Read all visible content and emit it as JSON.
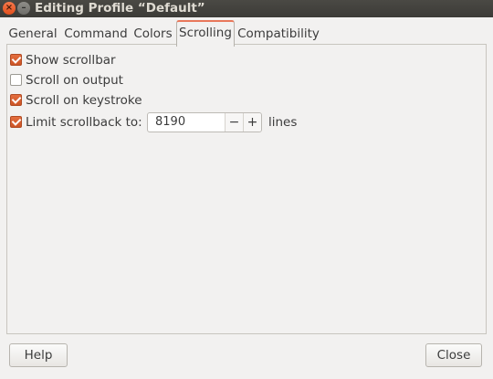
{
  "window": {
    "title": "Editing Profile “Default”",
    "close_glyph": "×",
    "minimize_glyph": "–"
  },
  "tabs": [
    {
      "label": "General"
    },
    {
      "label": "Command"
    },
    {
      "label": "Colors"
    },
    {
      "label": "Scrolling",
      "active": true
    },
    {
      "label": "Compatibility"
    }
  ],
  "options": {
    "show_scrollbar": {
      "label": "Show scrollbar",
      "checked": true
    },
    "scroll_on_output": {
      "label": "Scroll on output",
      "checked": false
    },
    "scroll_on_keystroke": {
      "label": "Scroll on keystroke",
      "checked": true
    },
    "limit_scrollback": {
      "label": "Limit scrollback to:",
      "checked": true
    }
  },
  "scrollback": {
    "value": "8190",
    "minus": "−",
    "plus": "+",
    "unit": "lines"
  },
  "buttons": {
    "help": "Help",
    "close": "Close"
  },
  "colors": {
    "accent": "#e46d3e",
    "titlebar": "#3c3b37"
  }
}
